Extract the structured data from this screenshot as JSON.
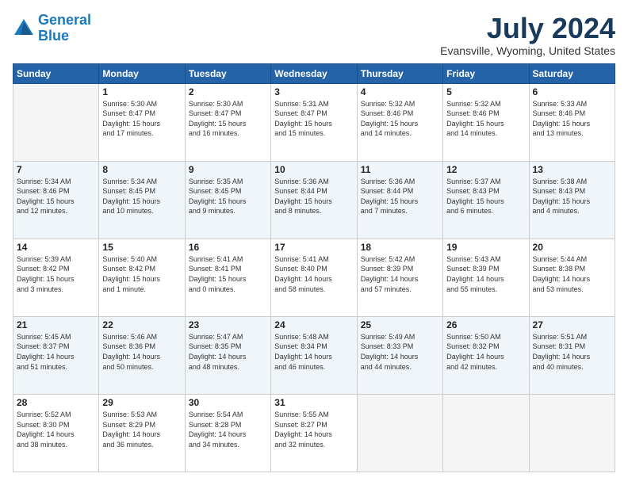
{
  "header": {
    "logo_line1": "General",
    "logo_line2": "Blue",
    "month": "July 2024",
    "location": "Evansville, Wyoming, United States"
  },
  "days_of_week": [
    "Sunday",
    "Monday",
    "Tuesday",
    "Wednesday",
    "Thursday",
    "Friday",
    "Saturday"
  ],
  "weeks": [
    [
      {
        "day": "",
        "info": ""
      },
      {
        "day": "1",
        "info": "Sunrise: 5:30 AM\nSunset: 8:47 PM\nDaylight: 15 hours\nand 17 minutes."
      },
      {
        "day": "2",
        "info": "Sunrise: 5:30 AM\nSunset: 8:47 PM\nDaylight: 15 hours\nand 16 minutes."
      },
      {
        "day": "3",
        "info": "Sunrise: 5:31 AM\nSunset: 8:47 PM\nDaylight: 15 hours\nand 15 minutes."
      },
      {
        "day": "4",
        "info": "Sunrise: 5:32 AM\nSunset: 8:46 PM\nDaylight: 15 hours\nand 14 minutes."
      },
      {
        "day": "5",
        "info": "Sunrise: 5:32 AM\nSunset: 8:46 PM\nDaylight: 15 hours\nand 14 minutes."
      },
      {
        "day": "6",
        "info": "Sunrise: 5:33 AM\nSunset: 8:46 PM\nDaylight: 15 hours\nand 13 minutes."
      }
    ],
    [
      {
        "day": "7",
        "info": "Sunrise: 5:34 AM\nSunset: 8:46 PM\nDaylight: 15 hours\nand 12 minutes."
      },
      {
        "day": "8",
        "info": "Sunrise: 5:34 AM\nSunset: 8:45 PM\nDaylight: 15 hours\nand 10 minutes."
      },
      {
        "day": "9",
        "info": "Sunrise: 5:35 AM\nSunset: 8:45 PM\nDaylight: 15 hours\nand 9 minutes."
      },
      {
        "day": "10",
        "info": "Sunrise: 5:36 AM\nSunset: 8:44 PM\nDaylight: 15 hours\nand 8 minutes."
      },
      {
        "day": "11",
        "info": "Sunrise: 5:36 AM\nSunset: 8:44 PM\nDaylight: 15 hours\nand 7 minutes."
      },
      {
        "day": "12",
        "info": "Sunrise: 5:37 AM\nSunset: 8:43 PM\nDaylight: 15 hours\nand 6 minutes."
      },
      {
        "day": "13",
        "info": "Sunrise: 5:38 AM\nSunset: 8:43 PM\nDaylight: 15 hours\nand 4 minutes."
      }
    ],
    [
      {
        "day": "14",
        "info": "Sunrise: 5:39 AM\nSunset: 8:42 PM\nDaylight: 15 hours\nand 3 minutes."
      },
      {
        "day": "15",
        "info": "Sunrise: 5:40 AM\nSunset: 8:42 PM\nDaylight: 15 hours\nand 1 minute."
      },
      {
        "day": "16",
        "info": "Sunrise: 5:41 AM\nSunset: 8:41 PM\nDaylight: 15 hours\nand 0 minutes."
      },
      {
        "day": "17",
        "info": "Sunrise: 5:41 AM\nSunset: 8:40 PM\nDaylight: 14 hours\nand 58 minutes."
      },
      {
        "day": "18",
        "info": "Sunrise: 5:42 AM\nSunset: 8:39 PM\nDaylight: 14 hours\nand 57 minutes."
      },
      {
        "day": "19",
        "info": "Sunrise: 5:43 AM\nSunset: 8:39 PM\nDaylight: 14 hours\nand 55 minutes."
      },
      {
        "day": "20",
        "info": "Sunrise: 5:44 AM\nSunset: 8:38 PM\nDaylight: 14 hours\nand 53 minutes."
      }
    ],
    [
      {
        "day": "21",
        "info": "Sunrise: 5:45 AM\nSunset: 8:37 PM\nDaylight: 14 hours\nand 51 minutes."
      },
      {
        "day": "22",
        "info": "Sunrise: 5:46 AM\nSunset: 8:36 PM\nDaylight: 14 hours\nand 50 minutes."
      },
      {
        "day": "23",
        "info": "Sunrise: 5:47 AM\nSunset: 8:35 PM\nDaylight: 14 hours\nand 48 minutes."
      },
      {
        "day": "24",
        "info": "Sunrise: 5:48 AM\nSunset: 8:34 PM\nDaylight: 14 hours\nand 46 minutes."
      },
      {
        "day": "25",
        "info": "Sunrise: 5:49 AM\nSunset: 8:33 PM\nDaylight: 14 hours\nand 44 minutes."
      },
      {
        "day": "26",
        "info": "Sunrise: 5:50 AM\nSunset: 8:32 PM\nDaylight: 14 hours\nand 42 minutes."
      },
      {
        "day": "27",
        "info": "Sunrise: 5:51 AM\nSunset: 8:31 PM\nDaylight: 14 hours\nand 40 minutes."
      }
    ],
    [
      {
        "day": "28",
        "info": "Sunrise: 5:52 AM\nSunset: 8:30 PM\nDaylight: 14 hours\nand 38 minutes."
      },
      {
        "day": "29",
        "info": "Sunrise: 5:53 AM\nSunset: 8:29 PM\nDaylight: 14 hours\nand 36 minutes."
      },
      {
        "day": "30",
        "info": "Sunrise: 5:54 AM\nSunset: 8:28 PM\nDaylight: 14 hours\nand 34 minutes."
      },
      {
        "day": "31",
        "info": "Sunrise: 5:55 AM\nSunset: 8:27 PM\nDaylight: 14 hours\nand 32 minutes."
      },
      {
        "day": "",
        "info": ""
      },
      {
        "day": "",
        "info": ""
      },
      {
        "day": "",
        "info": ""
      }
    ]
  ]
}
